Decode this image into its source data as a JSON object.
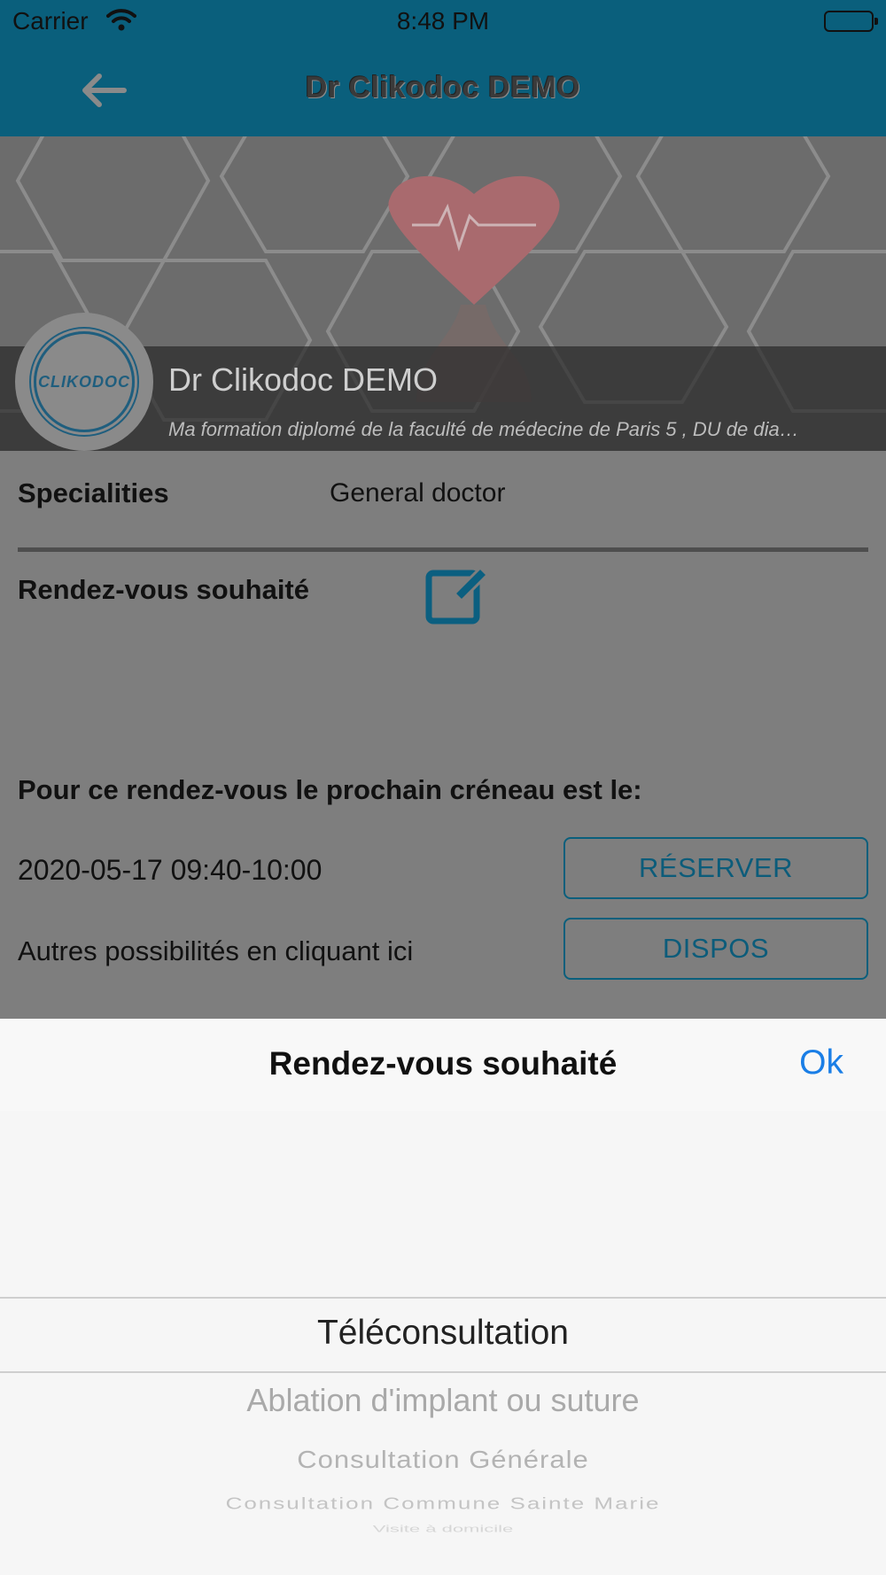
{
  "status_bar": {
    "carrier": "Carrier",
    "time": "8:48 PM",
    "wifi_icon": "wifi-icon",
    "battery_icon": "battery-full-icon"
  },
  "nav": {
    "back_icon": "arrow-left-icon",
    "title": "Dr Clikodoc DEMO"
  },
  "profile": {
    "name": "Dr Clikodoc DEMO",
    "description": "Ma formation diplomé de la faculté de médecine de Paris 5 , DU de dia…",
    "logo_text": "CLIKODOC"
  },
  "details": {
    "specialities_label": "Specialities",
    "specialities_value": "General doctor",
    "appointment_label": "Rendez-vous souhaité",
    "edit_icon": "edit-icon",
    "next_slot_label": "Pour ce rendez-vous le prochain créneau est le:",
    "next_slot_value": "2020-05-17 09:40-10:00",
    "reserve_button": "RÉSERVER",
    "other_label": "Autres possibilités en cliquant ici",
    "dispos_button": "DISPOS"
  },
  "picker_sheet": {
    "title": "Rendez-vous souhaité",
    "ok": "Ok",
    "options": [
      "Téléconsultation",
      "Ablation d'implant ou suture",
      "Consultation Générale",
      "Consultation Commune Sainte Marie",
      "Visite à domicile"
    ],
    "selected": "Téléconsultation"
  },
  "colors": {
    "nav_bar": "#0a5f7c",
    "accent": "#1a7ee6",
    "button_text": "#0c5c7a",
    "dim_overlay": "#7e7e7e"
  }
}
